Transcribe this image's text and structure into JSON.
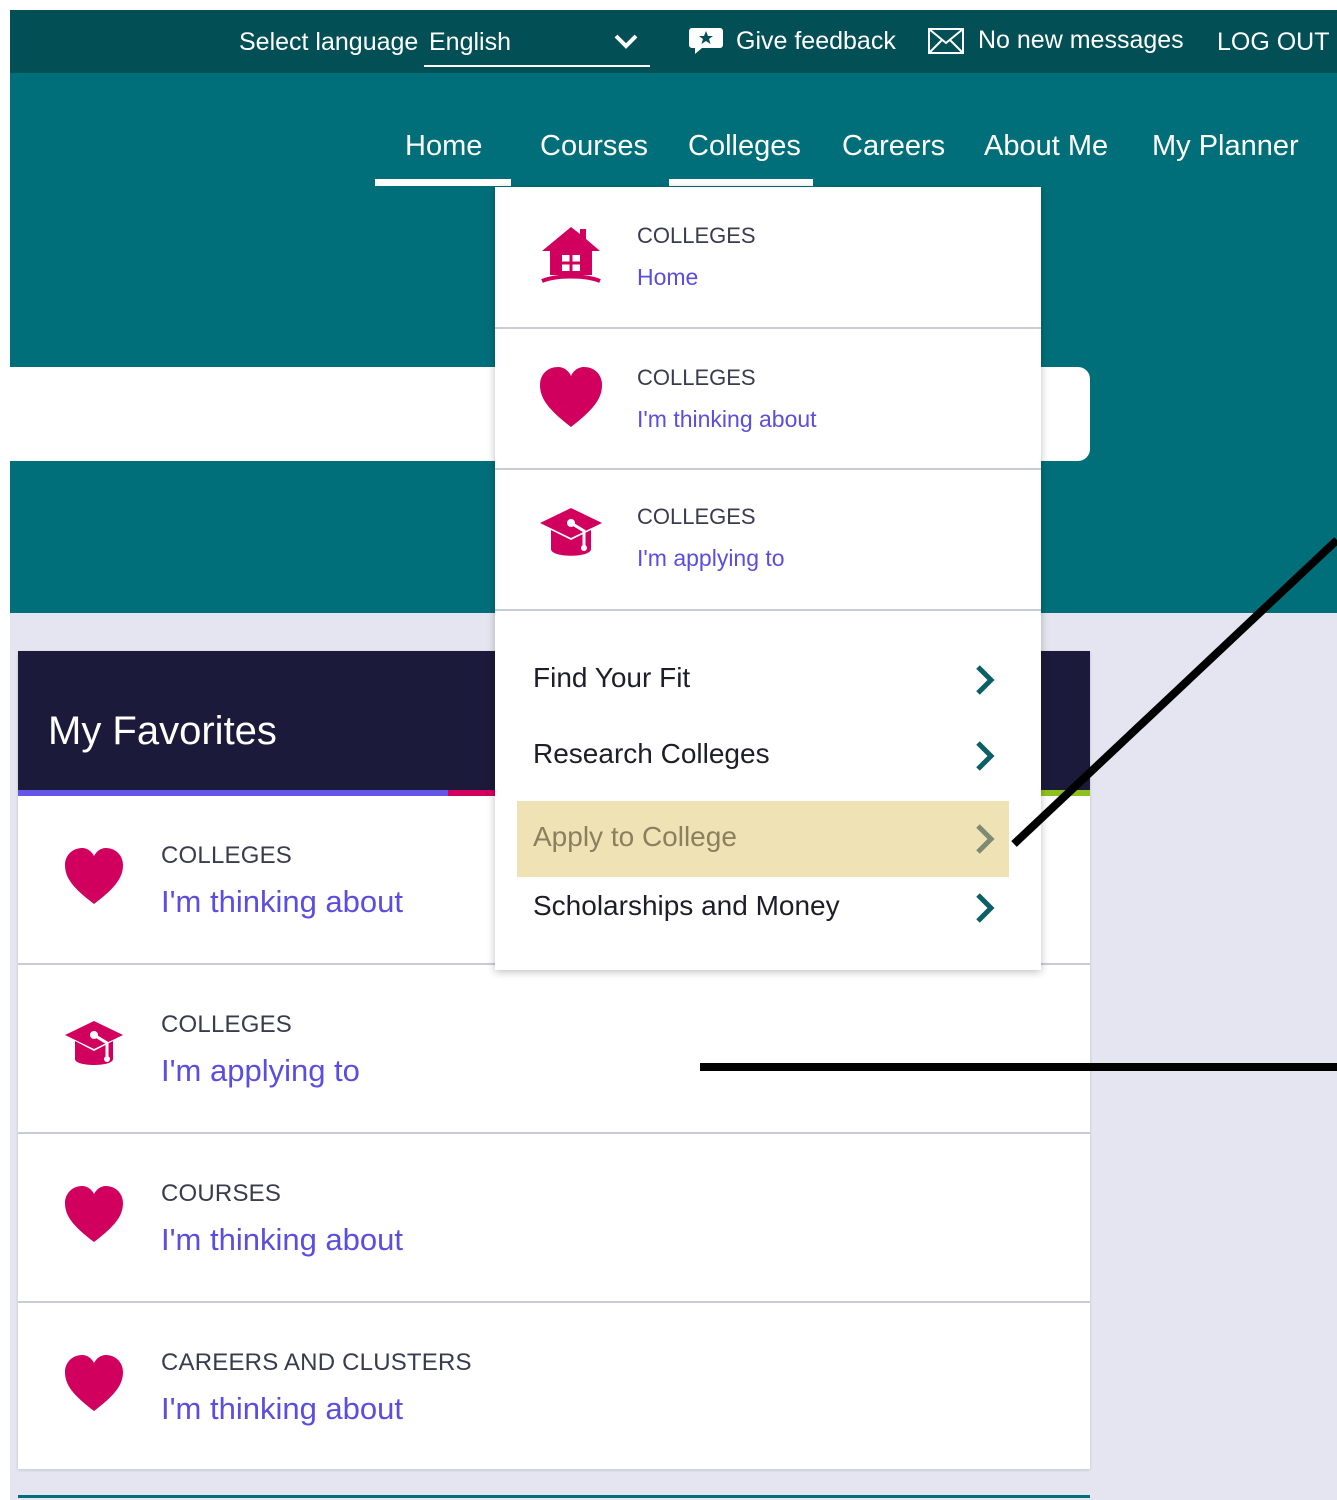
{
  "topbar": {
    "language_label": "Select language",
    "language_value": "English",
    "feedback_label": "Give feedback",
    "messages_label": "No new messages",
    "logout_label": "LOG OUT"
  },
  "nav": {
    "items": [
      {
        "label": "Home"
      },
      {
        "label": "Courses"
      },
      {
        "label": "Colleges"
      },
      {
        "label": "Careers"
      },
      {
        "label": "About Me"
      },
      {
        "label": "My Planner"
      }
    ]
  },
  "dropdown": {
    "sections": [
      {
        "category": "COLLEGES",
        "link": "Home",
        "icon": "house-icon"
      },
      {
        "category": "COLLEGES",
        "link": "I'm thinking about",
        "icon": "heart-icon"
      },
      {
        "category": "COLLEGES",
        "link": "I'm applying to",
        "icon": "graduation-cap-icon"
      }
    ],
    "items": [
      {
        "label": "Find Your Fit"
      },
      {
        "label": "Research Colleges"
      },
      {
        "label": "Apply to College"
      },
      {
        "label": "Scholarships and Money"
      }
    ]
  },
  "favorites": {
    "title": "My Favorites",
    "rows": [
      {
        "category": "COLLEGES",
        "link": "I'm thinking about",
        "icon": "heart-icon"
      },
      {
        "category": "COLLEGES",
        "link": "I'm applying to",
        "icon": "graduation-cap-icon"
      },
      {
        "category": "COURSES",
        "link": "I'm thinking about",
        "icon": "heart-icon"
      },
      {
        "category": "CAREERS AND CLUSTERS",
        "link": "I'm thinking about",
        "icon": "heart-icon"
      }
    ]
  },
  "colors": {
    "topbar": "#024f56",
    "header": "#006f79",
    "accent_pink": "#d1005f",
    "link_purple": "#5b4de0",
    "panel_dark": "#1b1a3a",
    "highlight": "#efe3b5"
  }
}
